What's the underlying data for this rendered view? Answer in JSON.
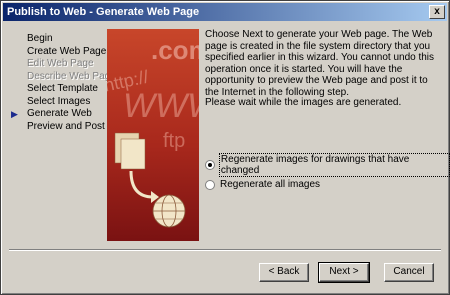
{
  "window": {
    "title": "Publish to Web - Generate Web Page",
    "close_glyph": "x"
  },
  "steps": [
    {
      "label": "Begin",
      "state": "normal"
    },
    {
      "label": "Create Web Page",
      "state": "normal"
    },
    {
      "label": "Edit Web Page",
      "state": "disabled"
    },
    {
      "label": "Describe Web Page",
      "state": "disabled"
    },
    {
      "label": "Select Template",
      "state": "normal"
    },
    {
      "label": "Select Images",
      "state": "normal"
    },
    {
      "label": "Generate Web",
      "state": "current"
    },
    {
      "label": "Preview  and Post",
      "state": "normal"
    }
  ],
  "current_marker": "▶",
  "illustration": {
    "texts": [
      ".com",
      "http://",
      "WWW",
      "ftp"
    ],
    "colors": {
      "top": "#c8462a",
      "bottom": "#7a1212",
      "text": "#e8a090",
      "doc": "#f2e6c8"
    }
  },
  "description": "Choose Next to generate your Web page.  The Web page is created in the file system directory that you specified earlier in this wizard.  You cannot undo this operation once it is started.  You will have the opportunity to preview the Web page and post it to the Internet in the following step.",
  "status": "Please wait while the images are generated.",
  "options": [
    {
      "label": "Regenerate images for drawings that have changed",
      "checked": true,
      "focused": true
    },
    {
      "label": "Regenerate all images",
      "checked": false,
      "focused": false
    }
  ],
  "buttons": {
    "back": "< Back",
    "next": "Next >",
    "cancel": "Cancel"
  }
}
